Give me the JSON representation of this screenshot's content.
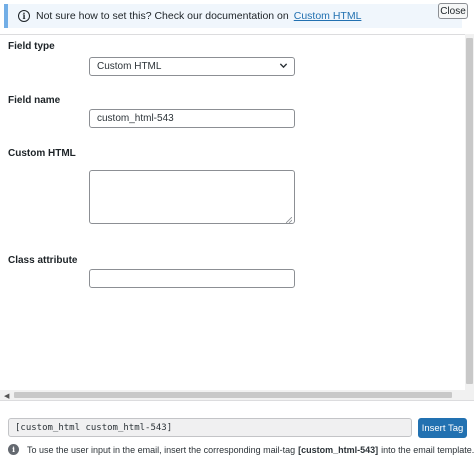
{
  "close_label": "Close",
  "notice": {
    "text": "Not sure how to set this? Check our documentation on",
    "link": "Custom HTML"
  },
  "fields": {
    "field_type": {
      "label": "Field type",
      "selected": "Custom HTML"
    },
    "field_name": {
      "label": "Field name",
      "value": "custom_html-543"
    },
    "custom_html": {
      "label": "Custom HTML",
      "value": ""
    },
    "class_attribute": {
      "label": "Class attribute",
      "value": ""
    }
  },
  "footer": {
    "tag": "[custom_html custom_html-543]",
    "insert_label": "Insert Tag",
    "hint_before": "To use the user input in the email, insert the corresponding mail-tag",
    "hint_tag": "[custom_html-543]",
    "hint_after": "into the email template."
  },
  "colors": {
    "accent": "#2271b1",
    "notice_bg": "#f0f6fc",
    "notice_border": "#72aee6"
  },
  "icons": {
    "notice": "info-circle-icon",
    "select": "chevron-down-icon",
    "hint": "info-filled-icon"
  }
}
